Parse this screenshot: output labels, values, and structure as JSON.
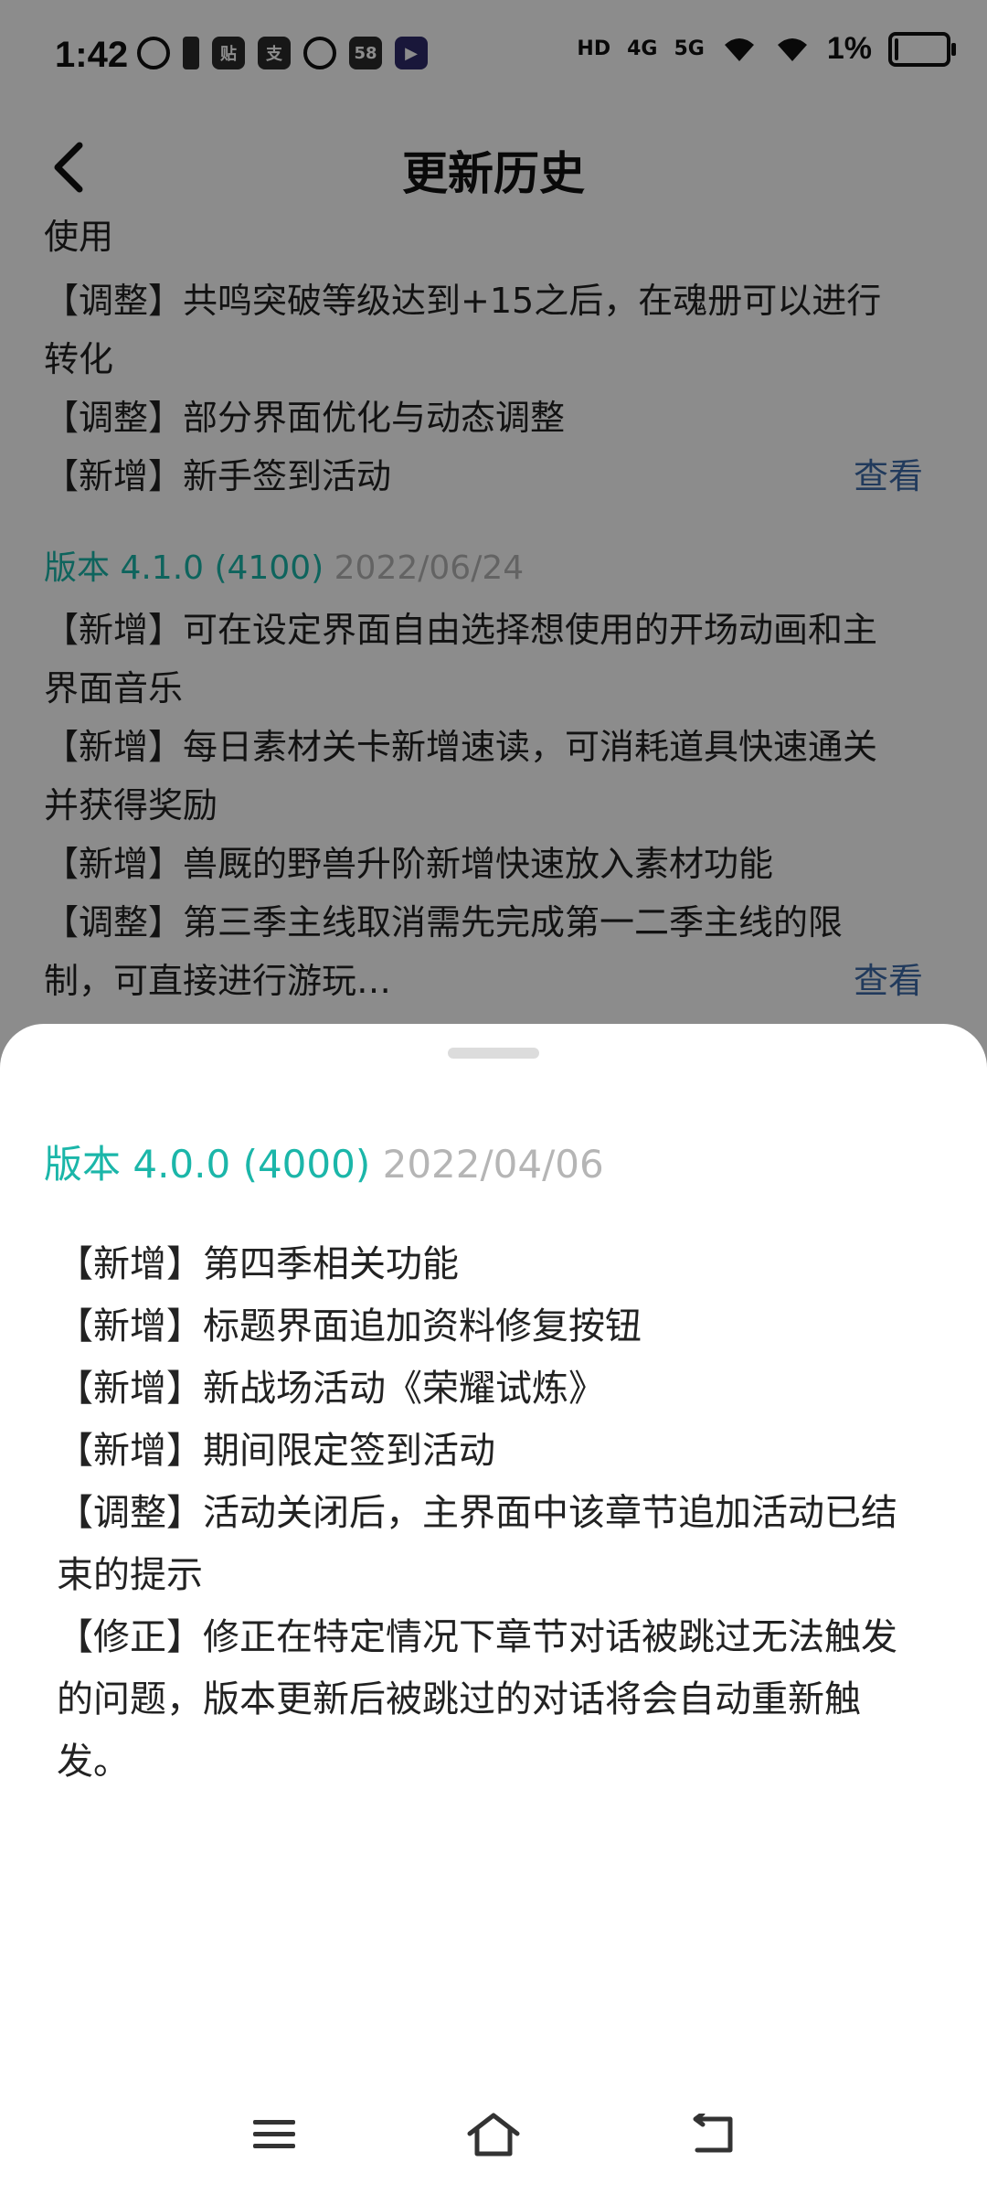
{
  "status_bar": {
    "time": "1:42",
    "left_icons": [
      "circle-app-icon",
      "battery-small-icon",
      "贴",
      "支",
      "wechat-icon",
      "58",
      "play-icon"
    ],
    "network_hd": "HD",
    "network_4g": "4G",
    "network_5g": "5G",
    "battery_percent": "1%"
  },
  "header": {
    "title": "更新历史"
  },
  "history": {
    "partial_top_line": "使用",
    "block1": [
      "【调整】共鸣突破等级达到+15之后，在魂册可以进行",
      "转化",
      "【调整】部分界面优化与动态调整",
      "【新增】新手签到活动"
    ],
    "view_label_1": "查看",
    "version2": {
      "label": "版本 4.1.0 (4100)",
      "date": "2022/06/24"
    },
    "block2": [
      "【新增】可在设定界面自由选择想使用的开场动画和主",
      "界面音乐",
      "【新增】每日素材关卡新增速读，可消耗道具快速通关",
      "并获得奖励",
      "【新增】兽厩的野兽升阶新增快速放入素材功能",
      "【调整】第三季主线取消需先完成第一二季主线的限",
      "制，可直接进行游玩…"
    ],
    "view_label_2": "查看"
  },
  "sheet": {
    "version": {
      "label": "版本 4.0.0 (4000)",
      "date": "2022/04/06"
    },
    "lines": [
      "【新增】第四季相关功能",
      "【新增】标题界面追加资料修复按钮",
      "【新增】新战场活动《荣耀试炼》",
      "【新增】期间限定签到活动",
      "【调整】活动关闭后，主界面中该章节追加活动已结",
      "束的提示",
      "【修正】修正在特定情况下章节对话被跳过无法触发",
      "的问题，版本更新后被跳过的对话将会自动重新触",
      "发。"
    ]
  },
  "colors": {
    "accent_teal": "#1bb6a9",
    "date_gray": "#b5b5b5",
    "link_blue": "#3d6aa8"
  },
  "navbar": {
    "icons": [
      "menu-icon",
      "home-icon",
      "back-nav-icon"
    ]
  }
}
